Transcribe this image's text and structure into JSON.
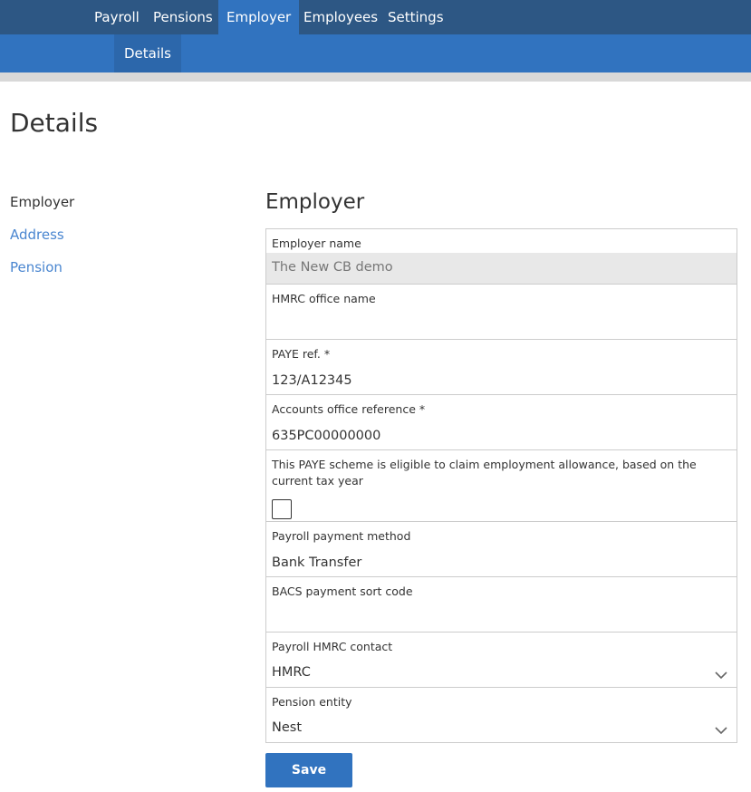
{
  "topnav": {
    "tabs": [
      {
        "label": "Payroll",
        "active": false
      },
      {
        "label": "Pensions",
        "active": false
      },
      {
        "label": "Employer",
        "active": true
      },
      {
        "label": "Employees",
        "active": false
      },
      {
        "label": "Settings",
        "active": false
      }
    ]
  },
  "subnav": {
    "tabs": [
      {
        "label": "Details",
        "active": true
      }
    ]
  },
  "page": {
    "title": "Details"
  },
  "sidenav": {
    "items": [
      {
        "label": "Employer",
        "current": true
      },
      {
        "label": "Address",
        "current": false
      },
      {
        "label": "Pension",
        "current": false
      }
    ]
  },
  "section": {
    "title": "Employer"
  },
  "form": {
    "employer_name": {
      "label": "Employer name",
      "value": "The New CB demo",
      "readonly": true
    },
    "hmrc_office_name": {
      "label": "HMRC office name",
      "value": ""
    },
    "paye_ref": {
      "label": "PAYE ref. *",
      "value": "123/A12345"
    },
    "accounts_office_ref": {
      "label": "Accounts office reference *",
      "value": "635PC00000000"
    },
    "employment_allowance": {
      "label": "This PAYE scheme is eligible to claim employment allowance, based on the current tax year",
      "checked": false
    },
    "payroll_payment_method": {
      "label": "Payroll payment method",
      "value": "Bank Transfer"
    },
    "bacs_sort_code": {
      "label": "BACS payment sort code",
      "value": ""
    },
    "payroll_hmrc_contact": {
      "label": "Payroll HMRC contact",
      "value": "HMRC",
      "icon": "chevron-down-icon"
    },
    "pension_entity": {
      "label": "Pension entity",
      "value": "Nest",
      "icon": "chevron-down-icon"
    }
  },
  "actions": {
    "save_label": "Save"
  },
  "colors": {
    "topnav_bg": "#2d5784",
    "accent": "#3173bf",
    "subnav_active": "#2c67ab",
    "link": "#4a86d0",
    "readonly_bg": "#e8e8e8"
  }
}
